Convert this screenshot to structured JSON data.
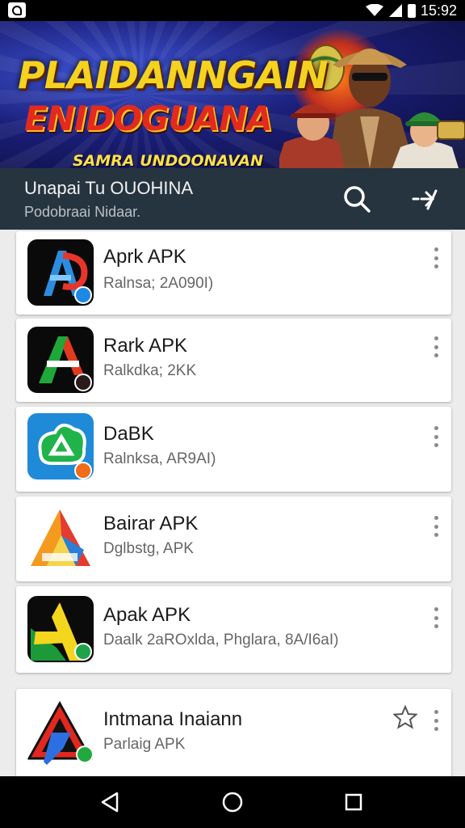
{
  "status_bar": {
    "time": "15:92",
    "icons": [
      "app-notification-icon",
      "wifi-icon",
      "cell-signal-icon",
      "battery-icon"
    ]
  },
  "banner": {
    "title_line1": "PLAIDANNGAIN",
    "title_line2": "ENIDOGUANA",
    "subtitle": "SAMRA UNDOONAVAN"
  },
  "appbar": {
    "title": "Unapai Tu OUOHINA",
    "subtitle": "Podobraai Nidaar.",
    "actions": [
      "search-icon",
      "share-arrow-icon"
    ]
  },
  "apps": [
    {
      "name": "Aprk APK",
      "meta": "Ralnsa; 2A090I)",
      "icon": "apk-a-blue-icon"
    },
    {
      "name": "Rark APK",
      "meta": "Ralkdka; 2KK",
      "icon": "apk-a-green-red-icon"
    },
    {
      "name": "DaBK",
      "meta": "Ralnksa, AR9AI)",
      "icon": "apk-green-cloud-icon"
    },
    {
      "name": "Bairar APK",
      "meta": "Dglbstg, APK",
      "icon": "apk-triangle-multicolor-icon"
    },
    {
      "name": "Apak APK",
      "meta": "Daalk 2aROxlda, Phglara, 8A/I6aI)",
      "icon": "apk-yellow-green-icon"
    },
    {
      "name": "Intmana Inaiann",
      "meta": "Parlaig APK",
      "icon": "apk-red-blue-a-icon",
      "starred": false
    }
  ],
  "nav": [
    "back-icon",
    "home-icon",
    "recents-icon"
  ],
  "colors": {
    "appbar": "#26343f",
    "banner_yellow": "#f4d21f",
    "banner_red": "#e32a1c",
    "card": "#ffffff",
    "background": "#ececec"
  }
}
